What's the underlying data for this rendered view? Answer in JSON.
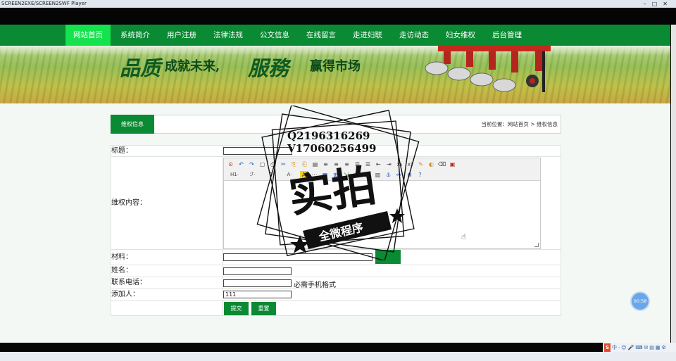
{
  "window": {
    "title": "SCREEN2EXE/SCREEN2SWF Player",
    "controls": [
      "–",
      "□",
      "✕"
    ]
  },
  "nav": {
    "items": [
      "网站首页",
      "系统简介",
      "用户注册",
      "法律法规",
      "公文信息",
      "在线留言",
      "走进妇联",
      "走访动态",
      "妇女维权",
      "后台管理"
    ],
    "active_index": 0
  },
  "banner": {
    "slogan_a": "品质",
    "slogan_b": "成就未来,",
    "slogan_c": "服務",
    "slogan_d": "赢得市场"
  },
  "panel": {
    "tab_label": "维权信息",
    "breadcrumb": "当前位置：网站首页 > 维权信息"
  },
  "form": {
    "title_label": "标题：",
    "content_label": "维权内容：",
    "material_label": "材料：",
    "name_label": "姓名：",
    "phone_label": "联系电话：",
    "phone_hint": "必需手机格式",
    "adder_label": "添加人：",
    "adder_value": "111",
    "submit_label": "提交",
    "reset_label": "重置"
  },
  "editor": {
    "row1": [
      "⊙",
      "↶",
      "↷",
      "▢",
      "⎙",
      "✂",
      "⎘",
      "⎗",
      "▤",
      "≡",
      "≡",
      "≡",
      "☰",
      "☰",
      "⇤",
      "⇥",
      "x₂",
      "x²",
      "✎",
      "◐",
      "⌫",
      "▣"
    ],
    "row2": [
      "H1·",
      "ℱ·",
      "T·",
      "A·",
      "A",
      "⋯",
      "▦",
      "⊞",
      "⇲",
      "☺",
      "▧",
      "▥",
      "⚓",
      "⚯",
      "⊗",
      "?"
    ]
  },
  "watermark": {
    "qq": "Q2196316269",
    "vx": "V17060256499",
    "main": "实拍",
    "sub": "全微程序"
  },
  "timer": "00:58",
  "tray": [
    "S",
    "中",
    "·",
    "☺",
    "🎤",
    "⌨",
    "✉",
    "▤",
    "▦",
    "⚙"
  ]
}
